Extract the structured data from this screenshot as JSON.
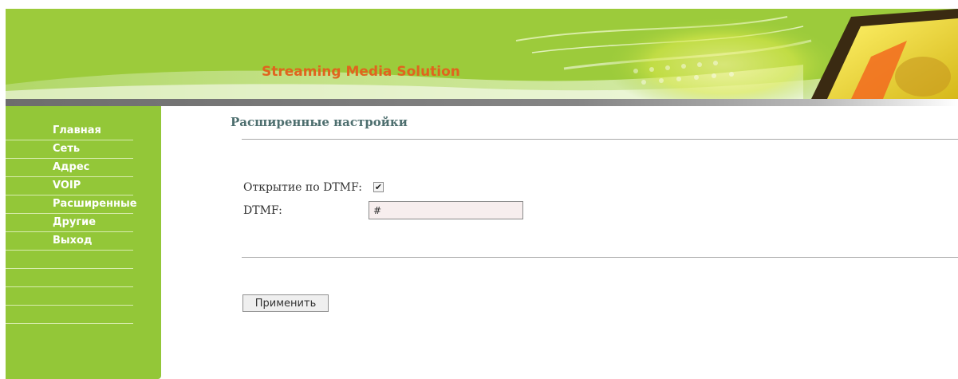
{
  "header": {
    "title": "Streaming Media Solution"
  },
  "sidebar": {
    "items": [
      {
        "label": "Главная"
      },
      {
        "label": "Сеть"
      },
      {
        "label": "Адрес"
      },
      {
        "label": "VOIP"
      },
      {
        "label": "Расширенные"
      },
      {
        "label": "Другие"
      },
      {
        "label": "Выход"
      }
    ]
  },
  "main": {
    "page_title": "Расширенные настройки",
    "dtmf_open_label": "Открытие по DTMF:",
    "dtmf_open_checked": true,
    "dtmf_label": "DTMF:",
    "dtmf_value": "#",
    "apply_label": "Применить"
  },
  "colors": {
    "banner_green": "#9ccb3b",
    "sidebar_green": "#93c738",
    "title_orange": "#e0641e",
    "heading_teal": "#4e6f6f"
  }
}
